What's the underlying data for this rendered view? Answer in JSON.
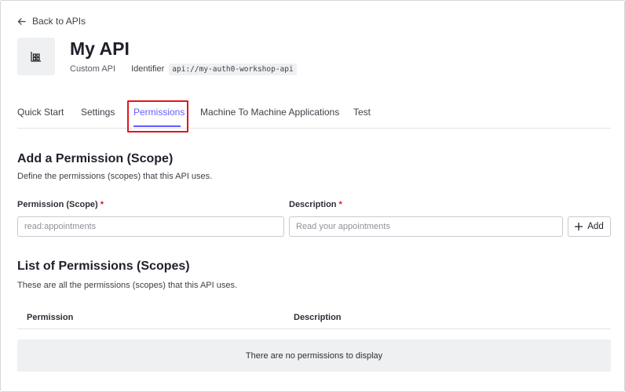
{
  "nav": {
    "back_label": "Back to APIs",
    "back_icon": "arrow-left-icon"
  },
  "api": {
    "icon": "building-grid-icon",
    "title": "My API",
    "type": "Custom API",
    "identifier_label": "Identifier",
    "identifier_value": "api://my-auth0-workshop-api"
  },
  "tabs": [
    {
      "label": "Quick Start",
      "active": false
    },
    {
      "label": "Settings",
      "active": false
    },
    {
      "label": "Permissions",
      "active": true
    },
    {
      "label": "Machine To Machine Applications",
      "active": false
    },
    {
      "label": "Test",
      "active": false
    }
  ],
  "add_section": {
    "title": "Add a Permission (Scope)",
    "description": "Define the permissions (scopes) that this API uses.",
    "permission_label": "Permission (Scope)",
    "permission_placeholder": "read:appointments",
    "description_label": "Description",
    "description_placeholder": "Read your appointments",
    "required_marker": "*",
    "add_button_label": "Add",
    "add_icon": "plus-icon"
  },
  "list_section": {
    "title": "List of Permissions (Scopes)",
    "description": "These are all the permissions (scopes) that this API uses.",
    "columns": [
      "Permission",
      "Description"
    ],
    "empty_message": "There are no permissions to display"
  },
  "colors": {
    "accent": "#635dff",
    "highlight": "#e0161f",
    "required": "#e0161f"
  }
}
